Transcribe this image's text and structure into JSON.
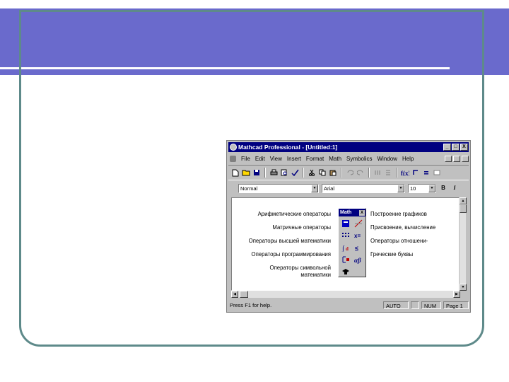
{
  "window": {
    "title": "Mathcad Professional - [Untitled:1]",
    "caption_buttons": [
      "_",
      "□",
      "X"
    ]
  },
  "menubar": {
    "items": [
      "File",
      "Edit",
      "View",
      "Insert",
      "Format",
      "Math",
      "Symbolics",
      "Window",
      "Help"
    ]
  },
  "formatbar": {
    "style": "Normal",
    "font": "Arial",
    "size": "10",
    "bold": "B",
    "italic": "I"
  },
  "palette": {
    "title": "Math",
    "close": "X"
  },
  "document": {
    "left_labels": [
      "Арифметические операторы",
      "Матричные операторы",
      "Операторы высшей математики",
      "Операторы программирования",
      "Операторы символьной",
      "математики"
    ],
    "right_labels": [
      "Построение графиков",
      "Присвоение, вычисление",
      "Операторы отношени-",
      "Греческие буквы"
    ]
  },
  "statusbar": {
    "hint": "Press F1 for help.",
    "mode": "AUTO",
    "num": "NUM",
    "page": "Page 1"
  },
  "colors": {
    "slide_header": "#6a6acc",
    "slide_frame": "#5e8a8a",
    "titlebar": "#000080"
  }
}
